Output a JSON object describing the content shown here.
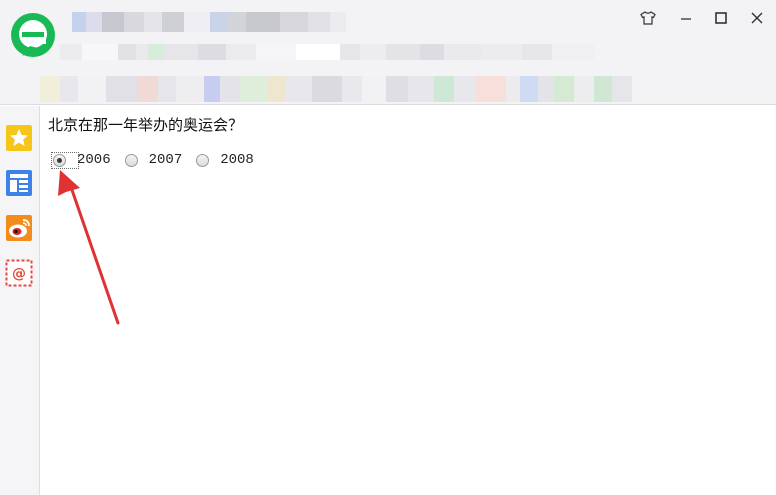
{
  "window": {
    "controls": [
      "skin-icon",
      "minimize-icon",
      "maximize-icon",
      "close-icon"
    ],
    "accent": "#19b955"
  },
  "sidebar": {
    "items": [
      {
        "icon": "favorites-star-icon",
        "color": "#f5c518"
      },
      {
        "icon": "news-reader-icon",
        "color": "#3c82e8"
      },
      {
        "icon": "weibo-icon",
        "color": "#f28c1c"
      },
      {
        "icon": "mail-at-icon",
        "color": "#e24b3c"
      }
    ]
  },
  "content": {
    "question": "北京在那一年举办的奥运会？",
    "options": [
      {
        "label": "2006",
        "checked": true
      },
      {
        "label": "2007",
        "checked": false
      },
      {
        "label": "2008",
        "checked": false
      }
    ]
  },
  "annotation": {
    "arrow_color": "#e03232"
  }
}
